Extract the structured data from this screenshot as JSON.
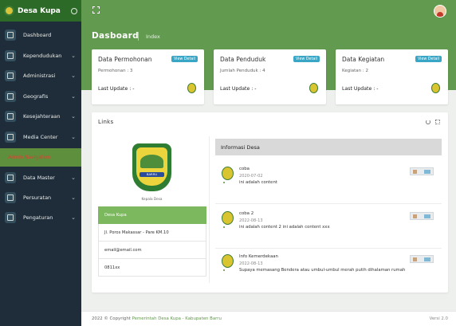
{
  "app": {
    "title": "Desa Kupa"
  },
  "sidebar": {
    "items": [
      {
        "label": "Dashboard",
        "icon": "home-icon",
        "has_children": false
      },
      {
        "label": "Kependudukan",
        "icon": "users-icon",
        "has_children": true
      },
      {
        "label": "Administrasi",
        "icon": "briefcase-icon",
        "has_children": true
      },
      {
        "label": "Geografis",
        "icon": "map-icon",
        "has_children": true
      },
      {
        "label": "Kesejahteraan",
        "icon": "box-icon",
        "has_children": true
      },
      {
        "label": "Media Center",
        "icon": "video-icon",
        "has_children": true
      }
    ],
    "section_label": "Admin Navigation",
    "admin_items": [
      {
        "label": "Data Master",
        "icon": "monitor-icon",
        "has_children": true
      },
      {
        "label": "Persuratan",
        "icon": "file-icon",
        "has_children": true
      },
      {
        "label": "Pengaturan",
        "icon": "settings-icon",
        "has_children": true
      }
    ],
    "chevron": "⌄"
  },
  "header": {
    "page_title": "Dasboard",
    "breadcrumb": "Index"
  },
  "cards": [
    {
      "title": "Data Permohonan",
      "button": "View Detail",
      "count": "Permohonan : 3",
      "last_update": "Last Update : -"
    },
    {
      "title": "Data Penduduk",
      "button": "View Detail",
      "count": "Jumlah Penduduk : 4",
      "last_update": "Last Update : -"
    },
    {
      "title": "Data Kegiatan",
      "button": "View Detail",
      "count": "Kegiatan : 2",
      "last_update": "Last Update : -"
    }
  ],
  "links": {
    "title": "Links",
    "emblem_text": "BARRU",
    "emblem_caption": "Kepala Desa",
    "info": [
      "Desa Kupa",
      "Jl. Poros Makassar - Pare KM.10",
      "email@email.com",
      "0811xx"
    ],
    "info_header": "Informasi Desa",
    "posts": [
      {
        "title": "coba",
        "date": "2020-07-02",
        "content": "ini adalah content"
      },
      {
        "title": "coba 2",
        "date": "2022-08-13",
        "content": "ini adalah content 2 ini adalah content xxx"
      },
      {
        "title": "Info Kemerdekaan",
        "date": "2022-08-13",
        "content": "Supaya memasang Bendera atau umbul-umbul merah putih dihalaman rumah"
      }
    ]
  },
  "footer": {
    "copy_prefix": "2022 © Copyright",
    "copy_link": "Pemerintah Desa Kupa - Kabupaten Barru",
    "version": "Versi 2.0"
  },
  "colors": {
    "primary_green": "#629a4f",
    "sidebar_dark": "#1f2d3a",
    "accent_blue": "#3aa6c6",
    "section_red": "#d3462f"
  }
}
